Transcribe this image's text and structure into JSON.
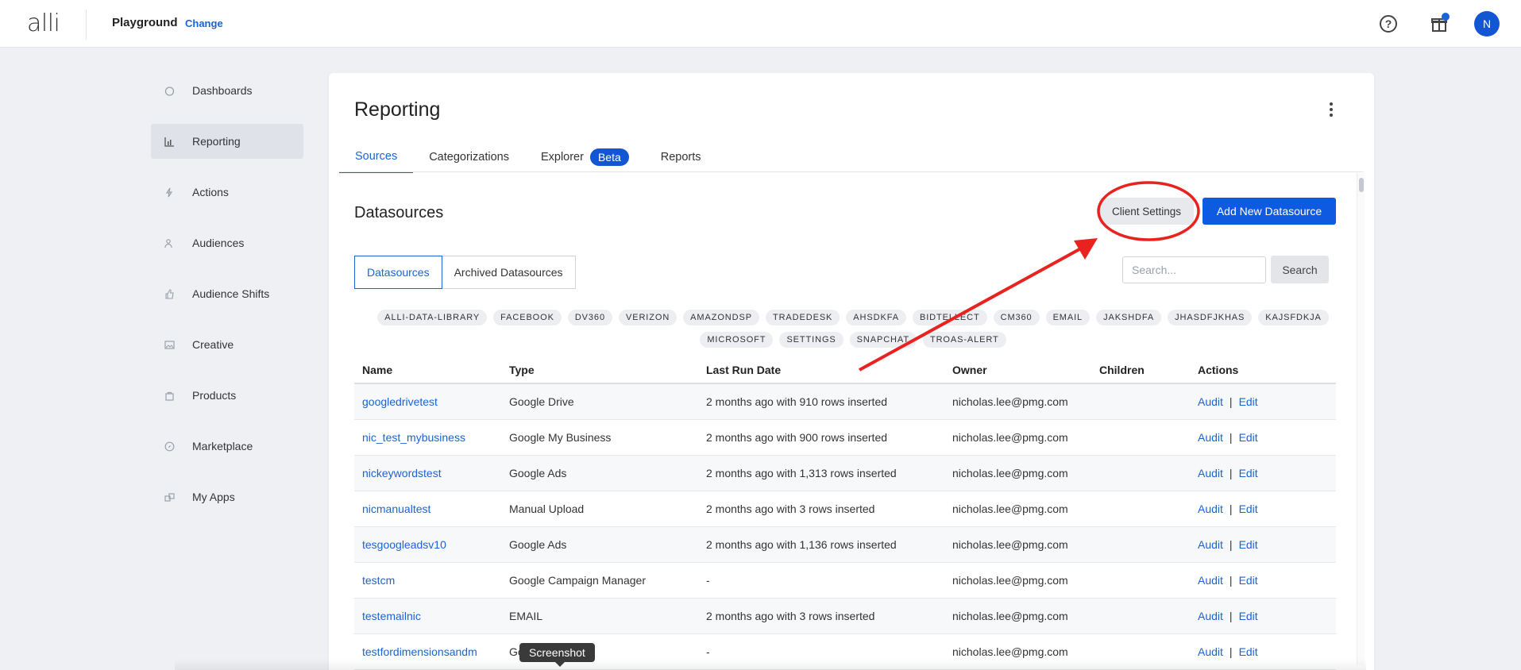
{
  "header": {
    "logo": "alli",
    "org_name": "Playground",
    "change_label": "Change",
    "avatar_initial": "N"
  },
  "sidebar": {
    "items": [
      {
        "label": "Dashboards",
        "icon": "dashboard-icon",
        "active": false
      },
      {
        "label": "Reporting",
        "icon": "bar-chart-icon",
        "active": true
      },
      {
        "label": "Actions",
        "icon": "lightning-icon",
        "active": false
      },
      {
        "label": "Audiences",
        "icon": "people-icon",
        "active": false
      },
      {
        "label": "Audience Shifts",
        "icon": "thumb-icon",
        "active": false
      },
      {
        "label": "Creative",
        "icon": "image-icon",
        "active": false
      },
      {
        "label": "Products",
        "icon": "bag-icon",
        "active": false
      },
      {
        "label": "Marketplace",
        "icon": "compass-icon",
        "active": false
      },
      {
        "label": "My Apps",
        "icon": "apps-icon",
        "active": false
      }
    ]
  },
  "main": {
    "title": "Reporting",
    "tabs": [
      {
        "label": "Sources",
        "active": true
      },
      {
        "label": "Categorizations",
        "active": false
      },
      {
        "label": "Explorer",
        "badge": "Beta",
        "active": false
      },
      {
        "label": "Reports",
        "active": false
      }
    ],
    "section_title": "Datasources",
    "client_settings_label": "Client Settings",
    "add_datasource_label": "Add New Datasource",
    "segments": [
      {
        "label": "Datasources",
        "active": true
      },
      {
        "label": "Archived Datasources",
        "active": false
      }
    ],
    "search": {
      "placeholder": "Search...",
      "value": "",
      "button_label": "Search"
    },
    "chips": [
      "ALLI-DATA-LIBRARY",
      "FACEBOOK",
      "DV360",
      "VERIZON",
      "AMAZONDSP",
      "TRADEDESK",
      "AHSDKFA",
      "BIDTELLECT",
      "CM360",
      "EMAIL",
      "JAKSHDFA",
      "JHASDFJKHAS",
      "KAJSFDKJA",
      "MICROSOFT",
      "SETTINGS",
      "SNAPCHAT",
      "TROAS-ALERT"
    ],
    "table": {
      "columns": [
        "Name",
        "Type",
        "Last Run Date",
        "Owner",
        "Children",
        "Actions"
      ],
      "audit_label": "Audit",
      "edit_label": "Edit",
      "separator": "|",
      "rows": [
        {
          "name": "googledrivetest",
          "type": "Google Drive",
          "last_run": "2 months ago with 910 rows inserted",
          "owner": "nicholas.lee@pmg.com",
          "children": ""
        },
        {
          "name": "nic_test_mybusiness",
          "type": "Google My Business",
          "last_run": "2 months ago with 900 rows inserted",
          "owner": "nicholas.lee@pmg.com",
          "children": ""
        },
        {
          "name": "nickeywordstest",
          "type": "Google Ads",
          "last_run": "2 months ago with 1,313 rows inserted",
          "owner": "nicholas.lee@pmg.com",
          "children": ""
        },
        {
          "name": "nicmanualtest",
          "type": "Manual Upload",
          "last_run": "2 months ago with 3 rows inserted",
          "owner": "nicholas.lee@pmg.com",
          "children": ""
        },
        {
          "name": "tesgoogleadsv10",
          "type": "Google Ads",
          "last_run": "2 months ago with 1,136 rows inserted",
          "owner": "nicholas.lee@pmg.com",
          "children": ""
        },
        {
          "name": "testcm",
          "type": "Google Campaign Manager",
          "last_run": "-",
          "owner": "nicholas.lee@pmg.com",
          "children": ""
        },
        {
          "name": "testemailnic",
          "type": "EMAIL",
          "last_run": "2 months ago with 3 rows inserted",
          "owner": "nicholas.lee@pmg.com",
          "children": ""
        },
        {
          "name": "testfordimensionsandm",
          "type": "Google Analytics",
          "last_run": "-",
          "owner": "nicholas.lee@pmg.com",
          "children": ""
        }
      ]
    }
  },
  "annotation": {
    "tooltip": "Screenshot",
    "color": "#e8231f"
  }
}
